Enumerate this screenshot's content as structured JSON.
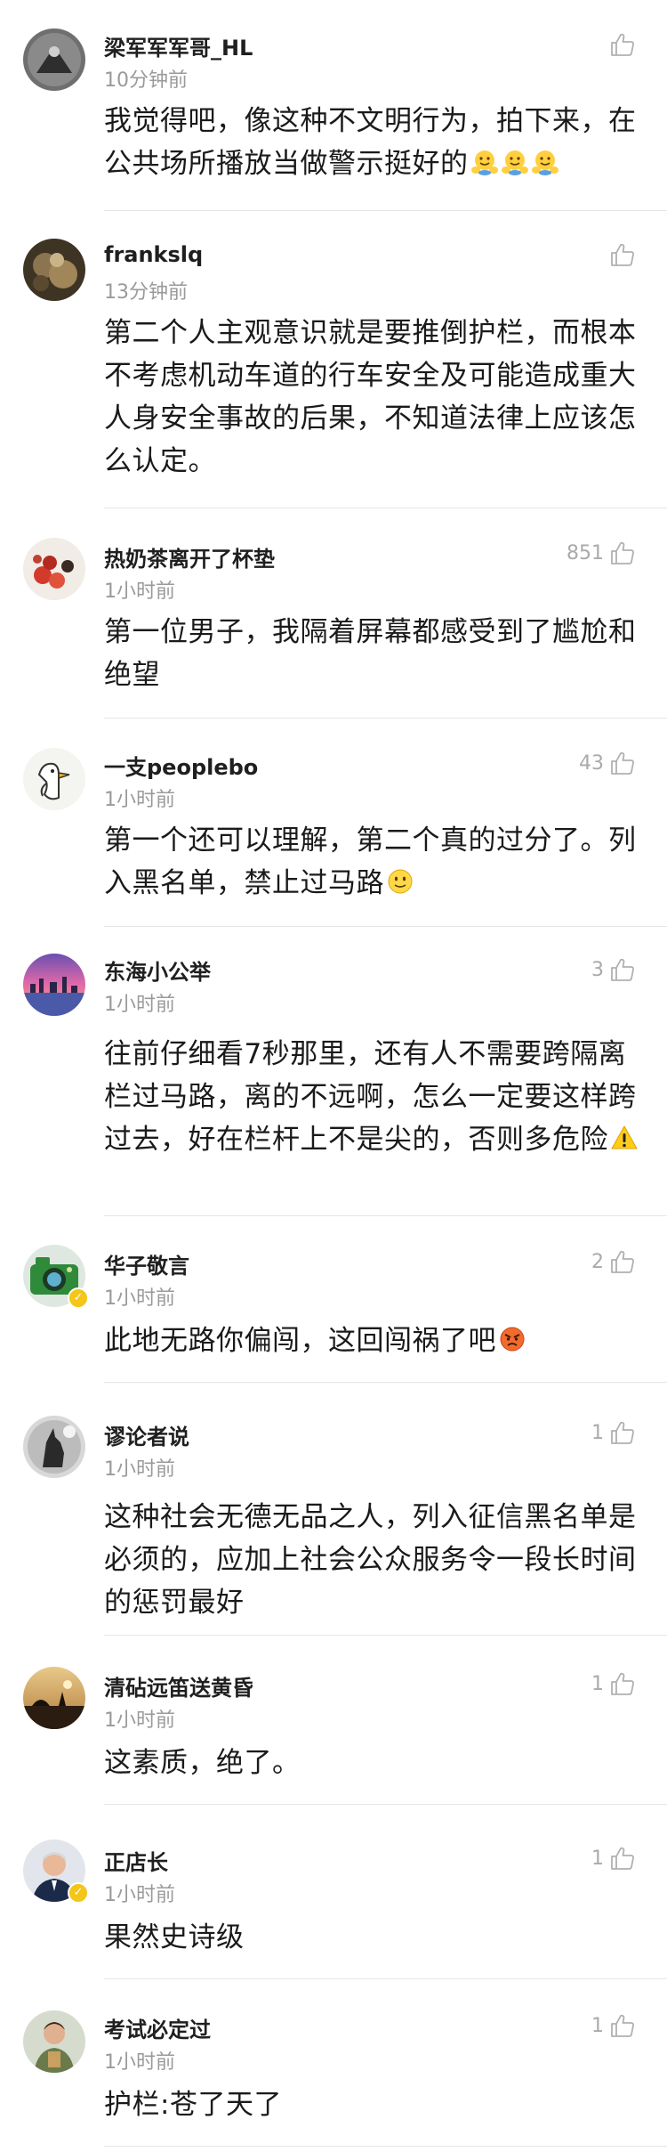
{
  "comments": [
    {
      "username": "梁军军军哥_HL",
      "time": "10分钟前",
      "likes": "",
      "text": "我觉得吧，像这种不文明行为，拍下来，在公共场所播放当做警示挺好的",
      "emoji_names": [
        "hug-emoji",
        "hug-emoji",
        "hug-emoji"
      ]
    },
    {
      "username": "frankslq",
      "time": "13分钟前",
      "likes": "",
      "text": "第二个人主观意识就是要推倒护栏，而根本不考虑机动车道的行车安全及可能造成重大人身安全事故的后果，不知道法律上应该怎么认定。",
      "emoji_names": []
    },
    {
      "username": "热奶茶离开了杯垫",
      "time": "1小时前",
      "likes": "851",
      "text": "第一位男子，我隔着屏幕都感受到了尴尬和绝望",
      "emoji_names": []
    },
    {
      "username": "一支peoplebo",
      "time": "1小时前",
      "likes": "43",
      "text": "第一个还可以理解，第二个真的过分了。列入黑名单，禁止过马路",
      "emoji_names": [
        "smile-emoji"
      ]
    },
    {
      "username": "东海小公举",
      "time": "1小时前",
      "likes": "3",
      "text": "往前仔细看7秒那里，还有人不需要跨隔离栏过马路，离的不远啊，怎么一定要这样跨过去，好在栏杆上不是尖的，否则多危险",
      "emoji_names": [
        "warning-emoji"
      ]
    },
    {
      "username": "华子敬言",
      "time": "1小时前",
      "likes": "2",
      "text": "此地无路你偏闯，这回闯祸了吧",
      "emoji_names": [
        "angry-emoji"
      ]
    },
    {
      "username": "谬论者说",
      "time": "1小时前",
      "likes": "1",
      "text": "这种社会无德无品之人，列入征信黑名单是必须的，应加上社会公众服务令一段长时间的惩罚最好",
      "emoji_names": []
    },
    {
      "username": "清砧远笛送黄昏",
      "time": "1小时前",
      "likes": "1",
      "text": "这素质，绝了。",
      "emoji_names": []
    },
    {
      "username": "正店长",
      "time": "1小时前",
      "likes": "1",
      "text": "果然史诗级",
      "emoji_names": []
    },
    {
      "username": "考试必定过",
      "time": "1小时前",
      "likes": "1",
      "text": "护栏:苍了天了",
      "emoji_names": []
    }
  ],
  "colors": {
    "username": "#1f1f1f",
    "time": "#9a9a9a",
    "like_count": "#aaaaaa",
    "text": "#1a1a1a",
    "divider": "#e6e6e6",
    "verified_badge": "#f5c518"
  }
}
